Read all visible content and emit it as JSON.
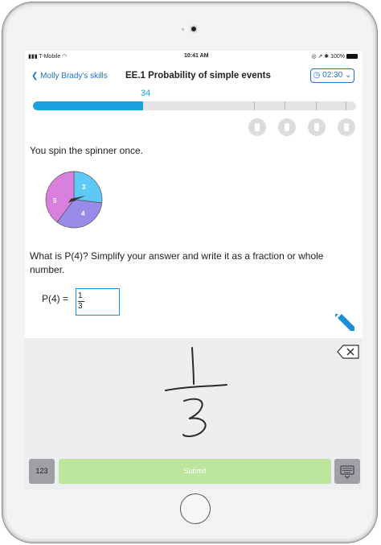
{
  "status_bar": {
    "carrier": "T-Mobile",
    "time": "10:41 AM",
    "battery": "100%"
  },
  "nav": {
    "back_label": "Molly Brady's skills",
    "title": "EE.1 Probability of simple events",
    "timer": "02:30"
  },
  "progress": {
    "score": "34",
    "fraction": 0.34,
    "medals": [
      "medal-1",
      "medal-2",
      "medal-3",
      "medal-4"
    ]
  },
  "question": {
    "intro": "You spin the spinner once.",
    "prompt": "What is P(4)? Simplify your answer and write it as a fraction or whole number.",
    "answer_label": "P(4) =",
    "answer_numerator": "1",
    "answer_denominator": "3"
  },
  "spinner": {
    "sections": [
      {
        "label": "3",
        "color": "#5fc9f5"
      },
      {
        "label": "4",
        "color": "#9b8be8"
      },
      {
        "label": "5",
        "color": "#d97fdd"
      }
    ]
  },
  "keypad": {
    "numbers_label": "123",
    "submit_label": "Submit"
  },
  "colors": {
    "accent": "#1a73c8",
    "progress": "#1aa3e0",
    "submit": "#bce69b"
  }
}
